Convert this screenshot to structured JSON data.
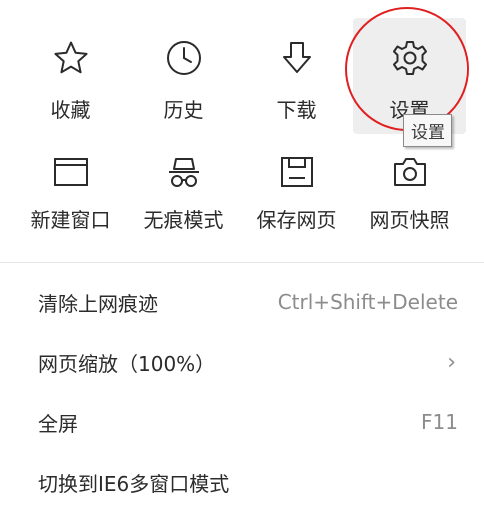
{
  "tiles_row1": [
    {
      "label": "收藏",
      "icon": "star-icon"
    },
    {
      "label": "历史",
      "icon": "clock-icon"
    },
    {
      "label": "下载",
      "icon": "download-icon"
    },
    {
      "label": "设置",
      "icon": "gear-icon"
    }
  ],
  "tiles_row2": [
    {
      "label": "新建窗口",
      "icon": "window-icon"
    },
    {
      "label": "无痕模式",
      "icon": "incognito-icon"
    },
    {
      "label": "保存网页",
      "icon": "save-icon"
    },
    {
      "label": "网页快照",
      "icon": "camera-icon"
    }
  ],
  "tooltip": "设置",
  "list": [
    {
      "label": "清除上网痕迹",
      "shortcut": "Ctrl+Shift+Delete"
    },
    {
      "label": "网页缩放（100%）",
      "chevron": "›"
    },
    {
      "label": "全屏",
      "shortcut": "F11"
    },
    {
      "label": "切换到IE6多窗口模式",
      "shortcut": ""
    }
  ],
  "colors": {
    "highlight_circle": "#e02020",
    "active_tile_bg": "#eeeeef",
    "shortcut_text": "#8c8c8c"
  }
}
